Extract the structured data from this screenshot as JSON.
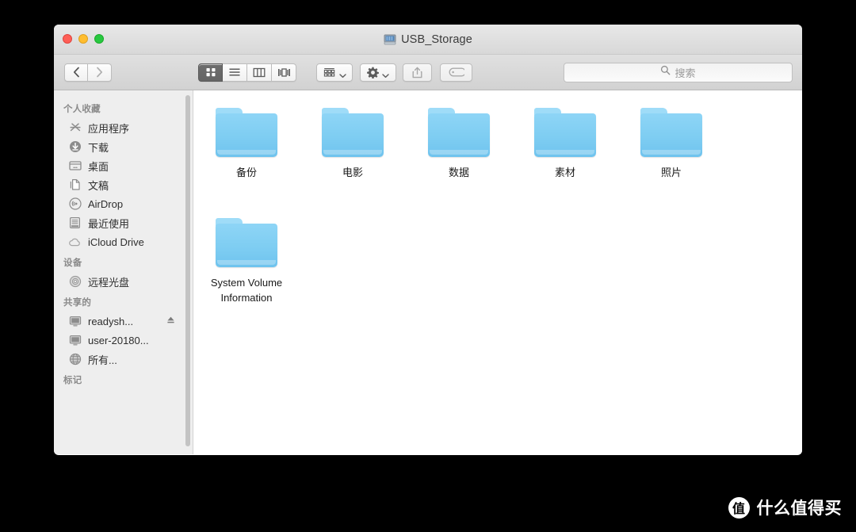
{
  "window": {
    "title": "USB_Storage",
    "title_icon": "hard-drive-icon",
    "traffic_lights": [
      {
        "name": "close",
        "color": "#ff5f57"
      },
      {
        "name": "minimize",
        "color": "#ffbd2e"
      },
      {
        "name": "zoom",
        "color": "#28c840"
      }
    ]
  },
  "toolbar": {
    "back_label": "‹",
    "forward_label": "›",
    "view_modes": [
      {
        "name": "icon-view",
        "active": true
      },
      {
        "name": "list-view",
        "active": false
      },
      {
        "name": "column-view",
        "active": false
      },
      {
        "name": "gallery-view",
        "active": false
      }
    ],
    "arrange_label": "arrange-icon",
    "action_label": "gear-icon",
    "share_label": "share-icon",
    "tag_label": "tag-icon"
  },
  "search": {
    "placeholder": "搜索",
    "value": "",
    "icon": "search-icon"
  },
  "sidebar": {
    "sections": [
      {
        "header": "个人收藏",
        "items": [
          {
            "label": "应用程序",
            "icon": "applications-icon",
            "eject": false
          },
          {
            "label": "下载",
            "icon": "downloads-icon",
            "eject": false
          },
          {
            "label": "桌面",
            "icon": "desktop-icon",
            "eject": false
          },
          {
            "label": "文稿",
            "icon": "documents-icon",
            "eject": false
          },
          {
            "label": "AirDrop",
            "icon": "airdrop-icon",
            "eject": false
          },
          {
            "label": "最近使用",
            "icon": "recents-icon",
            "eject": false
          },
          {
            "label": "iCloud Drive",
            "icon": "icloud-icon",
            "eject": false
          }
        ]
      },
      {
        "header": "设备",
        "items": [
          {
            "label": "远程光盘",
            "icon": "disc-icon",
            "eject": false
          }
        ]
      },
      {
        "header": "共享的",
        "items": [
          {
            "label": "readysh...",
            "icon": "computer-icon",
            "eject": true
          },
          {
            "label": "user-20180...",
            "icon": "computer-icon",
            "eject": false
          },
          {
            "label": "所有...",
            "icon": "network-globe-icon",
            "eject": false
          }
        ]
      },
      {
        "header": "标记",
        "items": []
      }
    ]
  },
  "content": {
    "files": [
      {
        "name": "备份",
        "type": "folder"
      },
      {
        "name": "电影",
        "type": "folder"
      },
      {
        "name": "数据",
        "type": "folder"
      },
      {
        "name": "素材",
        "type": "folder"
      },
      {
        "name": "照片",
        "type": "folder"
      },
      {
        "name": "System Volume Information",
        "type": "folder"
      }
    ]
  },
  "watermark": {
    "logo": "值",
    "text": "什么值得买"
  },
  "colors": {
    "folder_blue": "#7ecdf2",
    "sidebar_bg": "#eeeeee",
    "toolbar_bg": "#d8d8d8",
    "accent_active": "#6e6e6e"
  }
}
